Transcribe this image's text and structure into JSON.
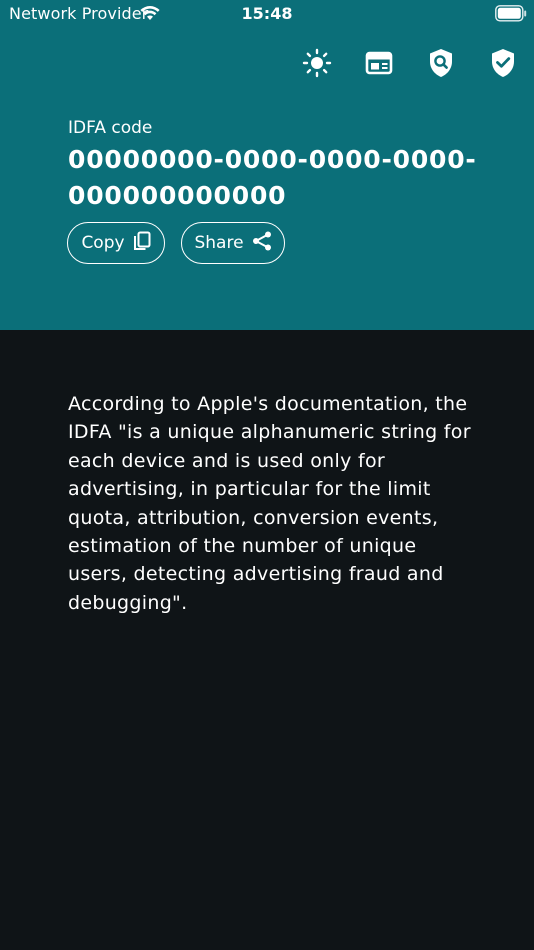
{
  "status_bar": {
    "carrier": "Network Provider",
    "time": "15:48",
    "icons": [
      "wifi-icon",
      "battery-icon"
    ]
  },
  "toolbar": {
    "icons": [
      "brightness-icon",
      "layout-icon",
      "privacy-search-icon",
      "verified-shield-icon"
    ]
  },
  "idfa": {
    "label": "IDFA code",
    "code": "00000000-0000-0000-0000-000000000000"
  },
  "actions": {
    "copy_label": "Copy",
    "copy_icon": "copy-icon",
    "share_label": "Share",
    "share_icon": "share-icon"
  },
  "description": "According to Apple's documentation, the IDFA \"is a unique alphanumeric string for each device and is used only for advertising, in particular for the limit quota, attribution, conversion events, estimation of the number of unique users, detecting advertising fraud and debugging\".",
  "colors": {
    "header_bg": "#0b6f79",
    "body_bg": "#0f1417",
    "text": "#ffffff"
  }
}
